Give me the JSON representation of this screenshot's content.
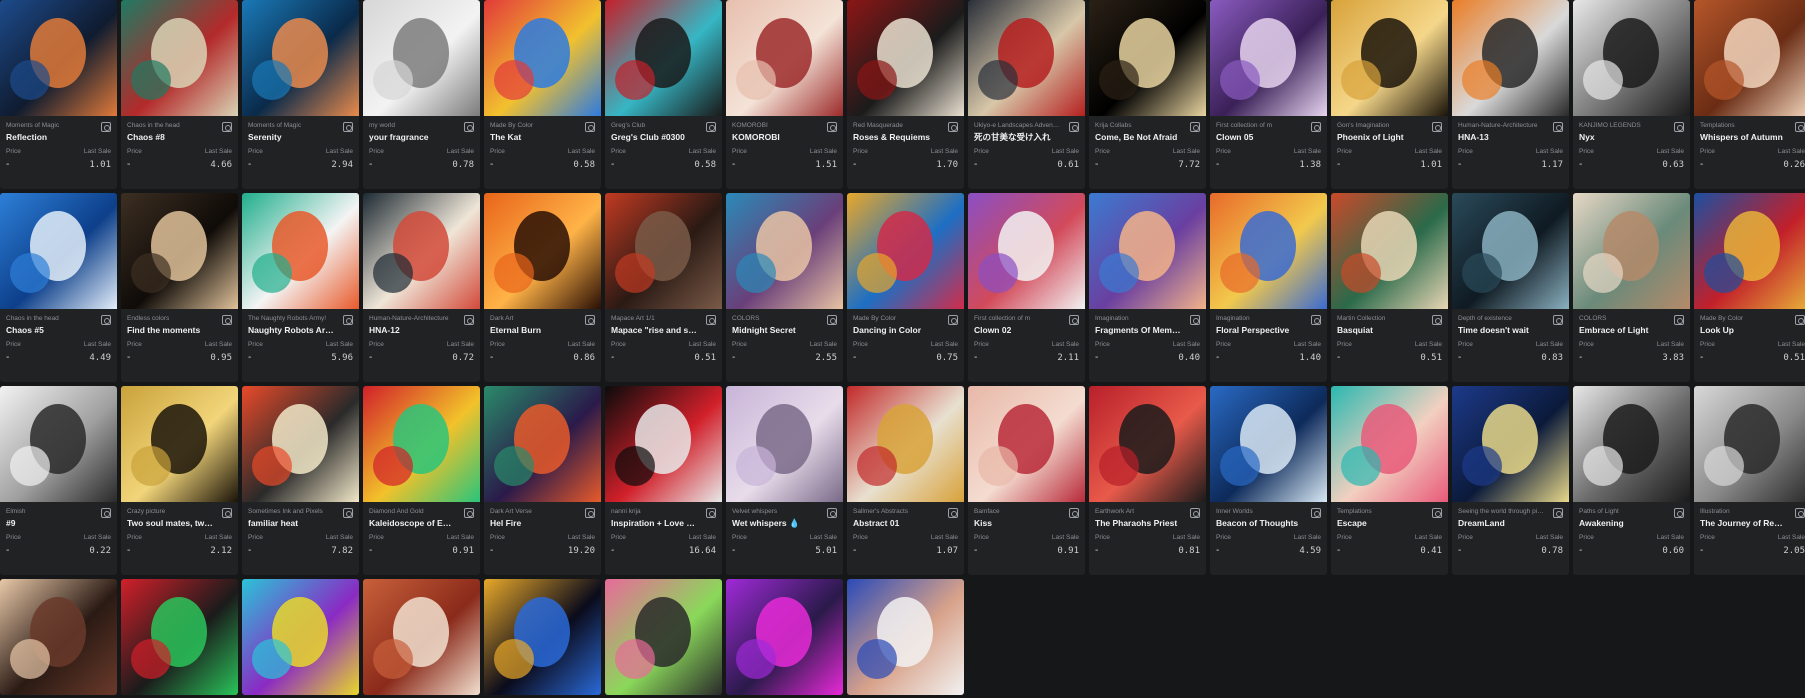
{
  "labels": {
    "price": "Price",
    "last_sale": "Last Sale"
  },
  "cards": [
    {
      "collection": "Moments of Magic",
      "title": "Reflection",
      "price": "-",
      "last_sale": "1.01",
      "colors": [
        "#1d4b8c",
        "#e07a3a",
        "#0f1b2f"
      ]
    },
    {
      "collection": "Chaos in the head",
      "title": "Chaos #8",
      "price": "-",
      "last_sale": "4.66",
      "colors": [
        "#1f7a63",
        "#d9d3b5",
        "#b32a2a"
      ]
    },
    {
      "collection": "Moments of Magic",
      "title": "Serenity",
      "price": "-",
      "last_sale": "2.94",
      "colors": [
        "#1a79b7",
        "#e98b4d",
        "#0a2a4a"
      ]
    },
    {
      "collection": "my world",
      "title": "your fragrance",
      "price": "-",
      "last_sale": "0.78",
      "colors": [
        "#d6d6d6",
        "#7c7c7c",
        "#f3f3f3"
      ]
    },
    {
      "collection": "Made By Color",
      "title": "The Kat",
      "price": "-",
      "last_sale": "0.58",
      "colors": [
        "#e23a3a",
        "#2d7be0",
        "#f2c12e"
      ]
    },
    {
      "collection": "Greg's Club",
      "title": "Greg's Club #0300",
      "price": "-",
      "last_sale": "0.58",
      "colors": [
        "#c4202a",
        "#1a1a1a",
        "#36b6c4"
      ]
    },
    {
      "collection": "KOMOROBI",
      "title": "KOMOROBI",
      "price": "-",
      "last_sale": "1.51",
      "colors": [
        "#e7bfae",
        "#9c2b2b",
        "#f4e3d7"
      ]
    },
    {
      "collection": "Red Masquerade",
      "title": "Roses & Requiems",
      "price": "-",
      "last_sale": "1.70",
      "colors": [
        "#8c1616",
        "#e9e0d0",
        "#1b1b1b"
      ]
    },
    {
      "collection": "Ukiyo-e Landscapes Adventures",
      "title": "死の甘美な受け入れ",
      "price": "-",
      "last_sale": "0.61",
      "colors": [
        "#2a2f3a",
        "#b52020",
        "#d7c7a8"
      ]
    },
    {
      "collection": "Krija Collabs",
      "title": "Come, Be Not Afraid",
      "price": "-",
      "last_sale": "7.72",
      "colors": [
        "#2b2116",
        "#e8d4a0",
        "#000000"
      ]
    },
    {
      "collection": "First collection of m",
      "title": "Clown 05",
      "price": "-",
      "last_sale": "1.38",
      "colors": [
        "#8a5bc0",
        "#e6d4ef",
        "#3a2057"
      ]
    },
    {
      "collection": "Gon's Imagination",
      "title": "Phoenix of Light",
      "price": "-",
      "last_sale": "1.01",
      "colors": [
        "#d8a23a",
        "#1b1409",
        "#f5d78a"
      ]
    },
    {
      "collection": "Human-Nature-Architecture",
      "title": "HNA-13",
      "price": "-",
      "last_sale": "1.17",
      "colors": [
        "#ea7d26",
        "#2a2a2a",
        "#d9d9d9"
      ]
    },
    {
      "collection": "KANJIMO LEGENDS",
      "title": "Nyx",
      "price": "-",
      "last_sale": "0.63",
      "colors": [
        "#e8e8e8",
        "#1b1b1b",
        "#7a7a7a"
      ]
    },
    {
      "collection": "Templations",
      "title": "Whispers of Autumn",
      "price": "-",
      "last_sale": "0.26",
      "colors": [
        "#b5562a",
        "#f2d5bd",
        "#6a2c14"
      ]
    },
    {
      "collection": "Chaos in the head",
      "title": "Chaos #5",
      "price": "-",
      "last_sale": "4.49",
      "colors": [
        "#2d7fd8",
        "#e3eef9",
        "#0d3f8a"
      ]
    },
    {
      "collection": "Endless colors",
      "title": "Find the moments",
      "price": "-",
      "last_sale": "0.95",
      "colors": [
        "#3d2f22",
        "#e0c29a",
        "#0f0b08"
      ]
    },
    {
      "collection": "The Naughty Robots Army!",
      "title": "Naughty Robots Army! ...",
      "price": "-",
      "last_sale": "5.96",
      "colors": [
        "#1fae8c",
        "#e85a2b",
        "#f4f4f4"
      ]
    },
    {
      "collection": "Human-Nature-Architecture",
      "title": "HNA-12",
      "price": "-",
      "last_sale": "0.72",
      "colors": [
        "#1d2a33",
        "#d24a3a",
        "#efe6d8"
      ]
    },
    {
      "collection": "Dark Art",
      "title": "Eternal Burn",
      "price": "-",
      "last_sale": "0.86",
      "colors": [
        "#e8641a",
        "#2a0f05",
        "#ffb347"
      ]
    },
    {
      "collection": "Mapace Art 1/1",
      "title": "Mapace \"rise and shine\"",
      "price": "-",
      "last_sale": "0.51",
      "colors": [
        "#c23a22",
        "#7a5a48",
        "#2a1a14"
      ]
    },
    {
      "collection": "COLORS",
      "title": "Midnight Secret",
      "price": "-",
      "last_sale": "2.55",
      "colors": [
        "#2a8ab8",
        "#e7c3a4",
        "#6a3f7a"
      ]
    },
    {
      "collection": "Made By Color",
      "title": "Dancing in Color",
      "price": "-",
      "last_sale": "0.75",
      "colors": [
        "#e8a72a",
        "#d12c4a",
        "#1d6fc4"
      ]
    },
    {
      "collection": "First collection of m",
      "title": "Clown 02",
      "price": "-",
      "last_sale": "2.11",
      "colors": [
        "#8a4fc4",
        "#f2f2f2",
        "#d24a5a"
      ]
    },
    {
      "collection": "Imagination",
      "title": "Fragments Of Memories...",
      "price": "-",
      "last_sale": "0.40",
      "colors": [
        "#3b7bd1",
        "#f2b38a",
        "#6a3fa0"
      ]
    },
    {
      "collection": "Imagination",
      "title": "Floral Perspective",
      "price": "-",
      "last_sale": "1.40",
      "colors": [
        "#e86a2a",
        "#3b6bd1",
        "#f2c94c"
      ]
    },
    {
      "collection": "Martin Collection",
      "title": "Basquiat",
      "price": "-",
      "last_sale": "0.51",
      "colors": [
        "#c94a2a",
        "#e8d6b5",
        "#2a6a4a"
      ]
    },
    {
      "collection": "Depth of existence",
      "title": "Time doesn't wait",
      "price": "-",
      "last_sale": "0.83",
      "colors": [
        "#2a4a5a",
        "#8ab0c0",
        "#0f1a22"
      ]
    },
    {
      "collection": "COLORS",
      "title": "Embrace of Light",
      "price": "-",
      "last_sale": "3.83",
      "colors": [
        "#e7d8c6",
        "#b58a6a",
        "#6a8a7a"
      ]
    },
    {
      "collection": "Made By Color",
      "title": "Look Up",
      "price": "-",
      "last_sale": "0.51",
      "colors": [
        "#1d4fa0",
        "#e8b23a",
        "#c2202a"
      ]
    },
    {
      "collection": "Elmish",
      "title": "#9",
      "price": "-",
      "last_sale": "0.22",
      "colors": [
        "#f2f2f2",
        "#2a2a2a",
        "#a0a0a0"
      ]
    },
    {
      "collection": "Crazy picture",
      "title": "Two soul mates, two op...",
      "price": "-",
      "last_sale": "2.12",
      "colors": [
        "#c9a23a",
        "#1b1409",
        "#f2d57a"
      ]
    },
    {
      "collection": "Sometimes Ink and Pixels",
      "title": "familiar heat",
      "price": "-",
      "last_sale": "7.82",
      "colors": [
        "#e84a2a",
        "#f2e8c8",
        "#2a2a2a"
      ]
    },
    {
      "collection": "Diamond And Gold",
      "title": "Kaleidoscope of Emotio...",
      "price": "-",
      "last_sale": "0.91",
      "colors": [
        "#d1202a",
        "#2ac47a",
        "#f2c22a"
      ]
    },
    {
      "collection": "Dark Art Verse",
      "title": "Hel Fire",
      "price": "-",
      "last_sale": "19.20",
      "colors": [
        "#2a8a6a",
        "#e85a2a",
        "#2a1a4a"
      ]
    },
    {
      "collection": "nanni krija",
      "title": "Inspiration + Love = ART",
      "price": "-",
      "last_sale": "16.64",
      "colors": [
        "#0b0b0b",
        "#e8e8e8",
        "#d1202a"
      ]
    },
    {
      "collection": "Velvet whispers",
      "title": "Wet whispers 💧",
      "price": "-",
      "last_sale": "5.01",
      "colors": [
        "#c8b4d8",
        "#7a6a8a",
        "#e8dcea"
      ]
    },
    {
      "collection": "Sallmer's Abstracts",
      "title": "Abstract 01",
      "price": "-",
      "last_sale": "1.07",
      "colors": [
        "#c22a2a",
        "#d8a23a",
        "#e8e0d0"
      ]
    },
    {
      "collection": "Bamface",
      "title": "Kiss",
      "price": "-",
      "last_sale": "0.91",
      "colors": [
        "#e8b8a8",
        "#b82a3a",
        "#f4dcd0"
      ]
    },
    {
      "collection": "Earthwork Art",
      "title": "The Pharaohs Priest",
      "price": "-",
      "last_sale": "0.81",
      "colors": [
        "#b8202a",
        "#1b1b1b",
        "#e85a4a"
      ]
    },
    {
      "collection": "Inner Worlds",
      "title": "Beacon of Thoughts",
      "price": "-",
      "last_sale": "4.59",
      "colors": [
        "#2a6ac4",
        "#d8e8f4",
        "#0d2a5a"
      ]
    },
    {
      "collection": "Templations",
      "title": "Escape",
      "price": "-",
      "last_sale": "0.41",
      "colors": [
        "#2ab8b0",
        "#e85a7a",
        "#f2d0c0"
      ]
    },
    {
      "collection": "Seeing the world through pix...",
      "title": "DreamLand",
      "price": "-",
      "last_sale": "0.78",
      "colors": [
        "#1d3a8a",
        "#e8d88a",
        "#0b1a3a"
      ]
    },
    {
      "collection": "Paths of Light",
      "title": "Awakening",
      "price": "-",
      "last_sale": "0.60",
      "colors": [
        "#e8e8e8",
        "#1b1b1b",
        "#6a6a6a"
      ]
    },
    {
      "collection": "Illustration",
      "title": "The Journey of Resilien...",
      "price": "-",
      "last_sale": "2.05",
      "colors": [
        "#d8d8d8",
        "#2a2a2a",
        "#8a8a8a"
      ]
    },
    {
      "collection": "",
      "title": "",
      "price": "",
      "last_sale": "",
      "colors": [
        "#e8c8a8",
        "#6a3a2a",
        "#2a1a14"
      ],
      "image_only": true
    },
    {
      "collection": "",
      "title": "",
      "price": "",
      "last_sale": "",
      "colors": [
        "#d1202a",
        "#2ac45a",
        "#1b1b1b"
      ],
      "image_only": true
    },
    {
      "collection": "",
      "title": "",
      "price": "",
      "last_sale": "",
      "colors": [
        "#2ac4d8",
        "#e8d82a",
        "#8a2ac4"
      ],
      "image_only": true
    },
    {
      "collection": "",
      "title": "",
      "price": "",
      "last_sale": "",
      "colors": [
        "#c8603a",
        "#f2e0d0",
        "#8a2a1a"
      ],
      "image_only": true
    },
    {
      "collection": "",
      "title": "",
      "price": "",
      "last_sale": "",
      "colors": [
        "#e8a82a",
        "#2a6ad8",
        "#0b0b1b"
      ],
      "image_only": true
    },
    {
      "collection": "",
      "title": "",
      "price": "",
      "last_sale": "",
      "colors": [
        "#e86a9a",
        "#2a2a2a",
        "#8ad85a"
      ],
      "image_only": true
    },
    {
      "collection": "",
      "title": "",
      "price": "",
      "last_sale": "",
      "colors": [
        "#a02ad8",
        "#e82ad8",
        "#2a1a4a"
      ],
      "image_only": true
    },
    {
      "collection": "",
      "title": "",
      "price": "",
      "last_sale": "",
      "colors": [
        "#2a4ab8",
        "#f2f2f2",
        "#d8a28a"
      ],
      "image_only": true
    }
  ]
}
